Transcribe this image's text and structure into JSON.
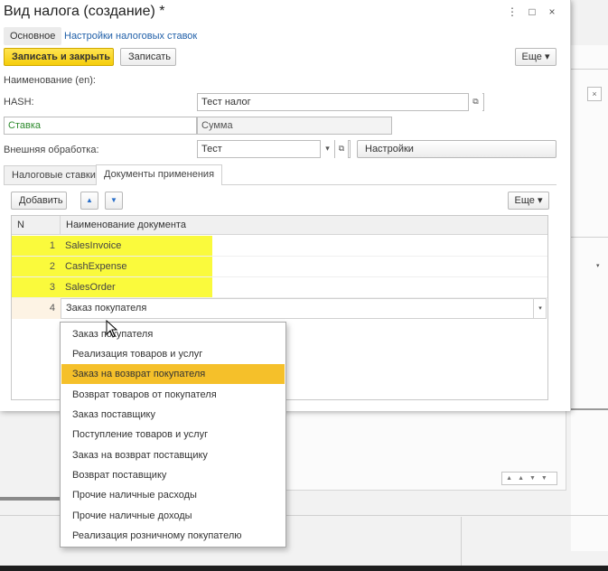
{
  "window": {
    "title": "Вид налога (создание) *",
    "controls": [
      "⋮",
      "□",
      "×"
    ]
  },
  "top_tabs": [
    "Основное",
    "Настройки налоговых ставок"
  ],
  "toolbar": {
    "save_close": "Записать и закрыть",
    "save": "Записать",
    "more": "Еще ▾"
  },
  "form": {
    "name_en_label": "Наименование (en):",
    "hash_label": "HASH:",
    "hash_value": "Тест налог",
    "rate_value": "Ставка",
    "sum_value": "Сумма",
    "ext_label": "Внешняя обработка:",
    "ext_value": "Тест",
    "settings_button": "Настройки"
  },
  "inner_tabs": [
    "Налоговые ставки",
    "Документы применения"
  ],
  "table_toolbar": {
    "add": "Добавить",
    "up_icon": "▲",
    "down_icon": "▼",
    "more": "Еще ▾"
  },
  "table": {
    "headers": [
      "N",
      "Наименование документа"
    ],
    "rows": [
      {
        "n": "1",
        "name": "SalesInvoice"
      },
      {
        "n": "2",
        "name": "CashExpense"
      },
      {
        "n": "3",
        "name": "SalesOrder"
      },
      {
        "n": "4",
        "name": "Заказ покупателя"
      }
    ]
  },
  "dropdown": {
    "items": [
      "Заказ покупателя",
      "Реализация товаров и услуг",
      "Заказ на возврат покупателя",
      "Возврат товаров от покупателя",
      "Заказ поставщику",
      "Поступление товаров и услуг",
      "Заказ на возврат поставщику",
      "Возврат поставщику",
      "Прочие наличные расходы",
      "Прочие наличные доходы",
      "Реализация розничному покупателю"
    ],
    "selected_index": 2
  },
  "colors": {
    "yellow_button": "#f5cd0b",
    "highlight_row": "#fafa3c",
    "dropdown_selected": "#f5c02a",
    "link": "#1f5fa8",
    "green_text": "#2e8b2e"
  }
}
